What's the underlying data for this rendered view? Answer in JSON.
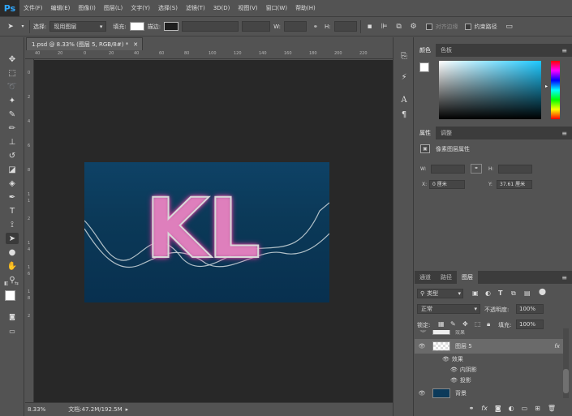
{
  "app": {
    "logo": "Ps"
  },
  "menu": [
    "文件(F)",
    "编辑(E)",
    "图像(I)",
    "图层(L)",
    "文字(Y)",
    "选择(S)",
    "滤镜(T)",
    "3D(D)",
    "视图(V)",
    "窗口(W)",
    "帮助(H)"
  ],
  "options": {
    "select_label": "选择:",
    "select_value": "现用图层",
    "fill_label": "填充:",
    "stroke_label": "描边:",
    "w_label": "W:",
    "h_label": "H:",
    "align_edges": "对齐边缘",
    "constrain_path": "约束路径"
  },
  "document": {
    "tab_title": "1.psd @ 8.33% (图层 5, RGB/8#) *",
    "zoom": "8.33%",
    "doc_info": "文档:47.2M/192.5M",
    "artwork_text": "KL",
    "ruler_top": [
      "40",
      "20",
      "0",
      "20",
      "40",
      "60",
      "80",
      "100",
      "120",
      "140",
      "160",
      "180",
      "200",
      "220"
    ],
    "ruler_left": [
      "0",
      "2",
      "4",
      "6",
      "8",
      "1",
      "1",
      "2",
      "1",
      "4",
      "1",
      "6",
      "1",
      "8",
      "2"
    ]
  },
  "color_panel": {
    "tabs": [
      "颜色",
      "色板"
    ],
    "active": 0
  },
  "properties_panel": {
    "tabs": [
      "属性",
      "调整"
    ],
    "active": 0,
    "title": "像素图层属性",
    "w_label": "W:",
    "h_label": "H:",
    "x_label": "X:",
    "x_value": "0 厘米",
    "y_label": "Y:",
    "y_value": "37.61 厘米"
  },
  "layers_panel": {
    "tabs": [
      "通道",
      "路径",
      "图层"
    ],
    "active": 2,
    "kind_filter": "类型",
    "blend_mode": "正常",
    "opacity_label": "不透明度:",
    "opacity_value": "100%",
    "lock_label": "锁定:",
    "fill_label": "填充:",
    "fill_value": "100%",
    "partial_layer": "效果",
    "layers": [
      {
        "name": "图层 5",
        "fx": "fx",
        "selected": true
      },
      {
        "name": "效果",
        "sub": true,
        "level": 1
      },
      {
        "name": "内阴影",
        "sub": true,
        "level": 2
      },
      {
        "name": "投影",
        "sub": true,
        "level": 2
      },
      {
        "name": "背景",
        "selected": false
      }
    ],
    "footer_icons": [
      "link-icon",
      "fx-icon",
      "mask-icon",
      "adjustment-icon",
      "group-icon",
      "new-layer-icon",
      "trash-icon"
    ]
  }
}
